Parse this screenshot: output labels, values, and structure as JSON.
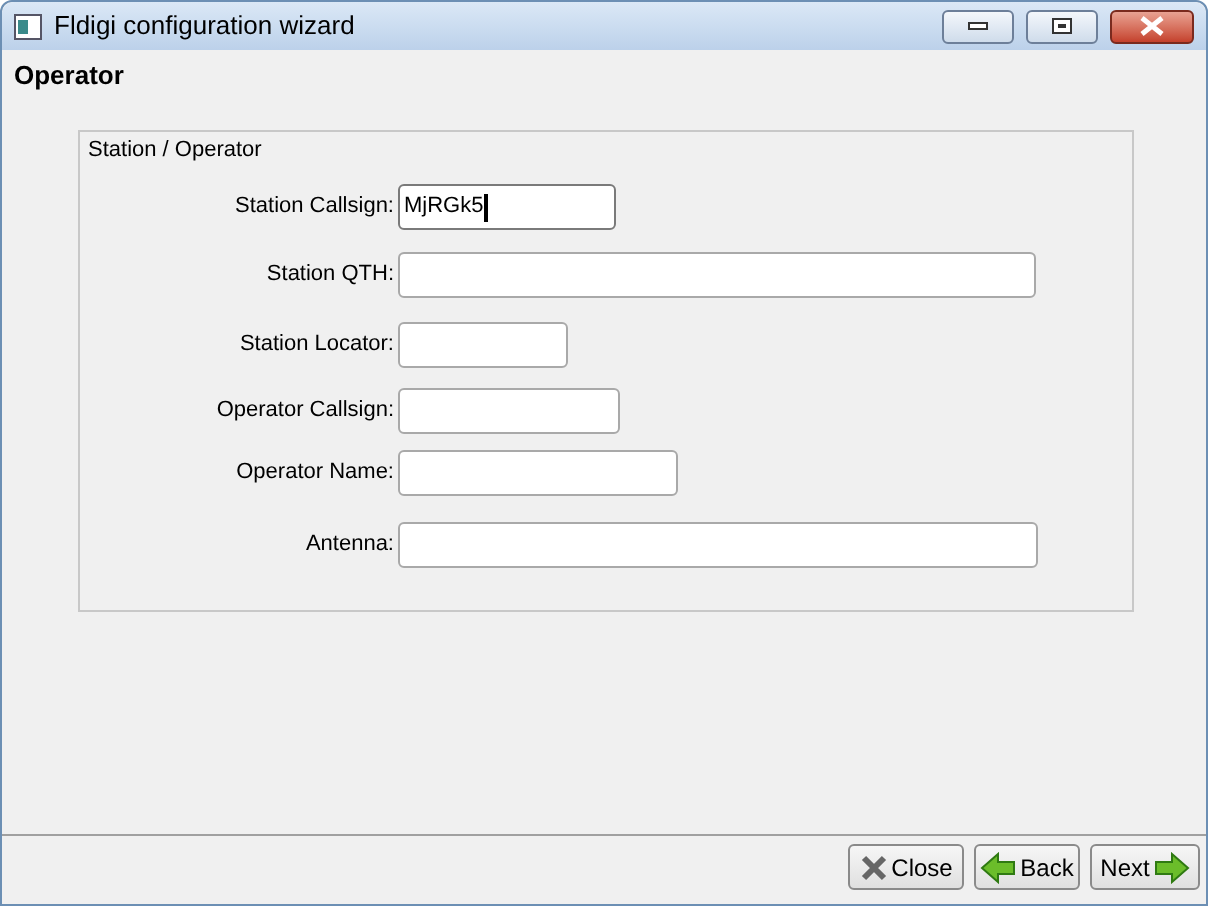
{
  "window": {
    "title": "Fldigi configuration wizard"
  },
  "page_heading": "Operator",
  "group": {
    "title": "Station / Operator",
    "fields": [
      {
        "label": "Station Callsign:",
        "value": "MjRGk5",
        "focused": true
      },
      {
        "label": "Station QTH:",
        "focused": false
      },
      {
        "label": "Station Locator:",
        "focused": false
      },
      {
        "label": "Operator Callsign:",
        "focused": false
      },
      {
        "label": "Operator Name:",
        "focused": false
      },
      {
        "label": "Antenna:",
        "focused": false
      }
    ]
  },
  "buttons": [
    {
      "kind": "close",
      "label": "Close"
    },
    {
      "kind": "back",
      "label": "Back"
    },
    {
      "kind": "next",
      "label": "Next"
    }
  ]
}
